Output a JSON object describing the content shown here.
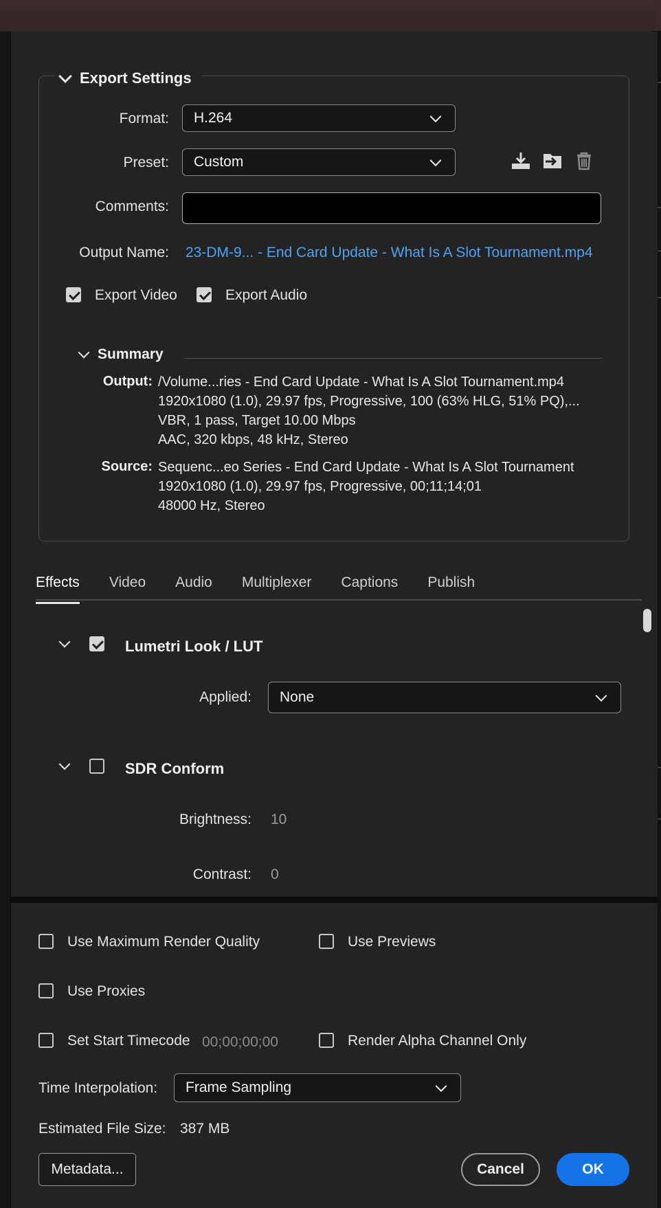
{
  "export_settings": {
    "title": "Export Settings",
    "format": {
      "label": "Format:",
      "value": "H.264"
    },
    "preset": {
      "label": "Preset:",
      "value": "Custom"
    },
    "comments": {
      "label": "Comments:",
      "value": ""
    },
    "output_name": {
      "label": "Output Name:",
      "value": "23-DM-9... - End Card Update - What Is A Slot Tournament.mp4"
    },
    "export_video": {
      "label": "Export Video",
      "checked": true
    },
    "export_audio": {
      "label": "Export Audio",
      "checked": true
    }
  },
  "summary": {
    "title": "Summary",
    "output_key": "Output:",
    "output_lines": [
      "/Volume...ries - End Card Update - What Is A Slot Tournament.mp4",
      "1920x1080 (1.0), 29.97 fps, Progressive, 100 (63% HLG, 51% PQ),...",
      "VBR, 1 pass, Target 10.00 Mbps",
      "AAC, 320 kbps, 48 kHz, Stereo"
    ],
    "source_key": "Source:",
    "source_lines": [
      "Sequenc...eo Series - End Card Update - What Is A Slot Tournament",
      "1920x1080 (1.0), 29.97 fps, Progressive, 00;11;14;01",
      "48000 Hz, Stereo"
    ]
  },
  "tabs": [
    "Effects",
    "Video",
    "Audio",
    "Multiplexer",
    "Captions",
    "Publish"
  ],
  "active_tab": "Effects",
  "effects": {
    "lumetri": {
      "title": "Lumetri Look / LUT",
      "checked": true,
      "applied_label": "Applied:",
      "applied_value": "None"
    },
    "sdr": {
      "title": "SDR Conform",
      "checked": false,
      "brightness_label": "Brightness:",
      "brightness_value": "10",
      "contrast_label": "Contrast:",
      "contrast_value": "0"
    }
  },
  "options": {
    "max_render_quality": "Use Maximum Render Quality",
    "use_previews": "Use Previews",
    "use_proxies": "Use Proxies",
    "set_start_timecode": "Set Start Timecode",
    "start_timecode_value": "00;00;00;00",
    "render_alpha": "Render Alpha Channel Only",
    "time_interpolation_label": "Time Interpolation:",
    "time_interpolation_value": "Frame Sampling",
    "estimated_size_label": "Estimated File Size:",
    "estimated_size_value": "387 MB"
  },
  "buttons": {
    "metadata": "Metadata...",
    "cancel": "Cancel",
    "ok": "OK"
  },
  "colors": {
    "accent": "#1473e6",
    "link": "#4da3f5",
    "background": "#232323"
  },
  "icons": [
    "save-preset-icon",
    "import-preset-icon",
    "trash-icon"
  ]
}
